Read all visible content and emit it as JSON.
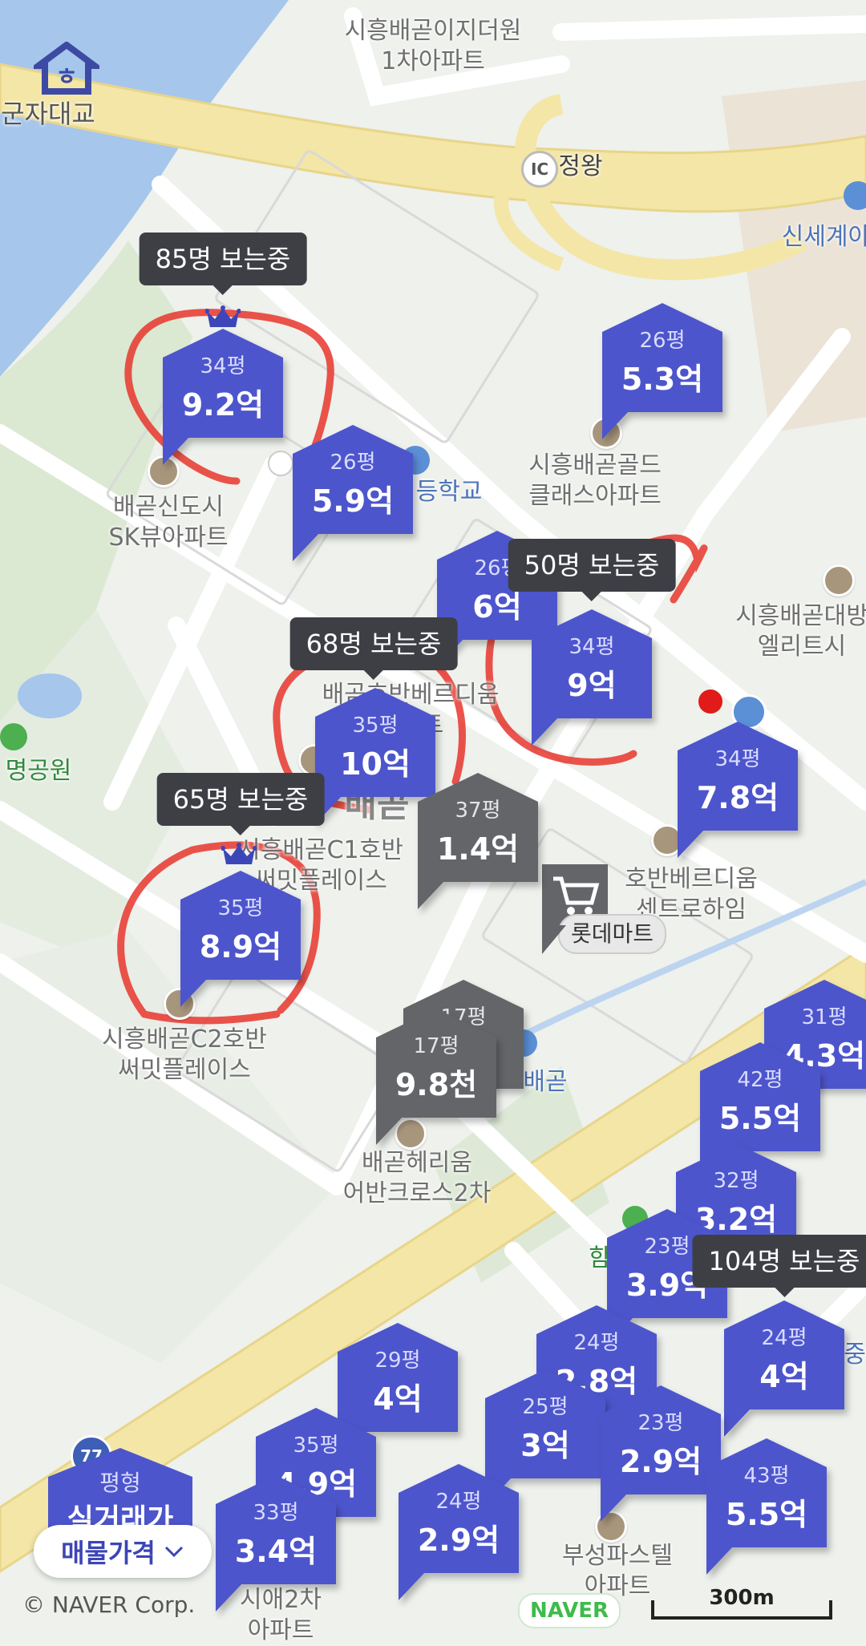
{
  "map_labels": {
    "gunja_bridge": "군자대교",
    "apt_ijidewon": "시흥배곧이지더원\n1차아파트",
    "ic_badge": "IC",
    "jeongwang": "정왕",
    "shinsegae": "신세계아",
    "gold_class": "시흥배곧골드\n클래스아파트",
    "elementary": "등학교",
    "sk_view": "배곧신도시\nSK뷰아파트",
    "daebang": "시흥배곧대방\n엘리트시",
    "hoban_verdium": "배곧호반베르디움\n아파트",
    "baegot_big": "배곧",
    "c1_summit": "시흥배곧C1호반\n써밋플레이스",
    "hoban_center": "호반베르디움\n센트로하임",
    "lotte_mart": "롯데마트",
    "c2_summit": "시흥배곧C2호반\n써밋플레이스",
    "baegot_station": "배곧",
    "hillstate": "배곧헤리움\n어반크로스2차",
    "park": "명공원",
    "boosung": "부성파스텔\n아파트",
    "bottom_left_apt": "시애2차\n아파트",
    "ham": "함",
    "road_77": "77",
    "bottom_right_partial": "중"
  },
  "markers": [
    {
      "pyung": "34평",
      "price": "9.2억",
      "type": "blue"
    },
    {
      "pyung": "26평",
      "price": "5.9억",
      "type": "blue"
    },
    {
      "pyung": "26평",
      "price": "5.3억",
      "type": "blue"
    },
    {
      "pyung": "26평",
      "price": "6억",
      "type": "blue"
    },
    {
      "pyung": "34평",
      "price": "9억",
      "type": "blue"
    },
    {
      "pyung": "35평",
      "price": "10억",
      "type": "blue"
    },
    {
      "pyung": "34평",
      "price": "7.8억",
      "type": "blue"
    },
    {
      "pyung": "37평",
      "price": "1.4억",
      "type": "gray"
    },
    {
      "pyung": "35평",
      "price": "8.9억",
      "type": "blue"
    },
    {
      "pyung": "17평",
      "price": "",
      "type": "gray"
    },
    {
      "pyung": "17평",
      "price": "9.8천",
      "type": "gray"
    },
    {
      "pyung": "31평",
      "price": "4.3억",
      "type": "blue"
    },
    {
      "pyung": "42평",
      "price": "5.5억",
      "type": "blue"
    },
    {
      "pyung": "32평",
      "price": "3.2억",
      "type": "blue"
    },
    {
      "pyung": "23평",
      "price": "3.9억",
      "type": "blue"
    },
    {
      "pyung": "24평",
      "price": "2.8억",
      "type": "blue"
    },
    {
      "pyung": "24평",
      "price": "4억",
      "type": "blue"
    },
    {
      "pyung": "29평",
      "price": "4억",
      "type": "blue"
    },
    {
      "pyung": "25평",
      "price": "3억",
      "type": "blue"
    },
    {
      "pyung": "23평",
      "price": "2.9억",
      "type": "blue"
    },
    {
      "pyung": "35평",
      "price": "4.9억",
      "type": "blue"
    },
    {
      "pyung": "43평",
      "price": "5.5억",
      "type": "blue"
    },
    {
      "pyung": "33평",
      "price": "3.4억",
      "type": "blue"
    },
    {
      "pyung": "24평",
      "price": "2.9억",
      "type": "blue"
    }
  ],
  "viewers": [
    "85명 보는중",
    "50명 보는중",
    "68명 보는중",
    "65명 보는중",
    "104명 보는중"
  ],
  "real_deal": {
    "pyung_label": "평형",
    "title": "실거래가"
  },
  "toggle": {
    "label": "매물가격"
  },
  "copyright": "© NAVER Corp.",
  "naver_logo": "NAVER",
  "scale": "300m",
  "colors": {
    "marker_blue": "#4d55cc",
    "marker_gray": "#636569",
    "annotation_red": "#e8362d",
    "water": "#a6c6ec"
  }
}
